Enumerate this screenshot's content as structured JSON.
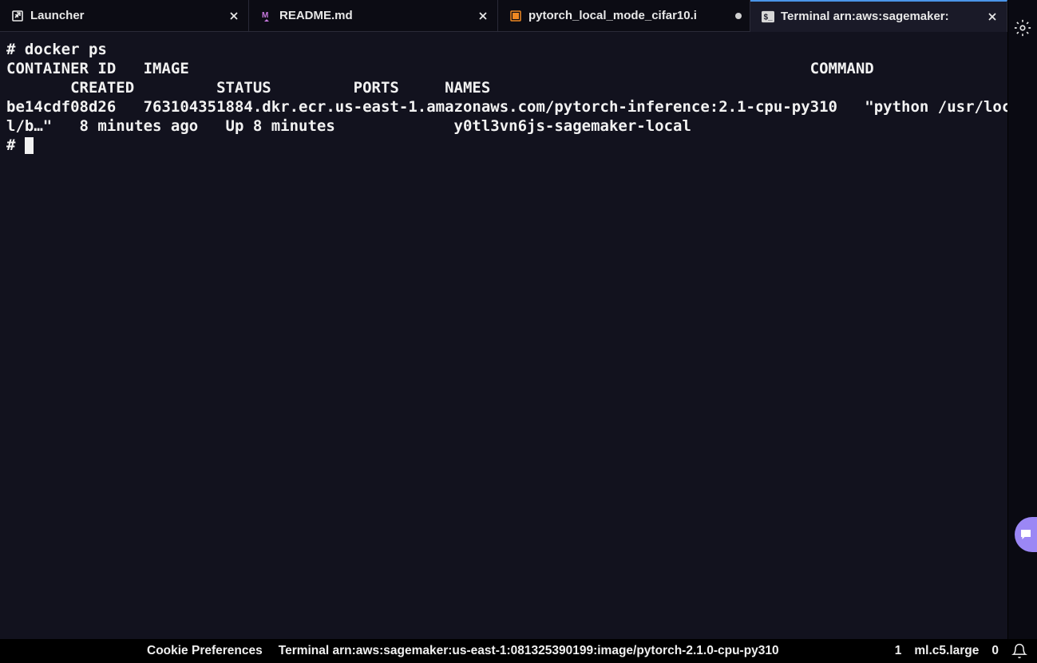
{
  "tabs": [
    {
      "label": "Launcher",
      "icon": "launcher",
      "closable": true,
      "active": false
    },
    {
      "label": "README.md",
      "icon": "markdown",
      "closable": true,
      "active": false
    },
    {
      "label": "pytorch_local_mode_cifar10.i",
      "icon": "notebook",
      "dirty": true,
      "active": false
    },
    {
      "label": "Terminal arn:aws:sagemaker:",
      "icon": "terminal",
      "closable": true,
      "active": true
    }
  ],
  "terminal": {
    "line1": "# docker ps",
    "line2_a": "CONTAINER ID   IMAGE                                                                    COMMAND",
    "line2_b": "       CREATED         STATUS         PORTS     NAMES",
    "line3_a": "be14cdf08d26   763104351884.dkr.ecr.us-east-1.amazonaws.com/pytorch-inference:2.1-cpu-py310   \"python /usr/loca",
    "line3_b": "l/b…\"   8 minutes ago   Up 8 minutes             y0tl3vn6js-sagemaker-local",
    "line4": "# "
  },
  "statusbar": {
    "cookie": "Cookie Preferences",
    "terminal_path": "Terminal arn:aws:sagemaker:us-east-1:081325390199:image/pytorch-2.1.0-cpu-py310",
    "number1": "1",
    "instance": "ml.c5.large",
    "notifications": "0"
  }
}
